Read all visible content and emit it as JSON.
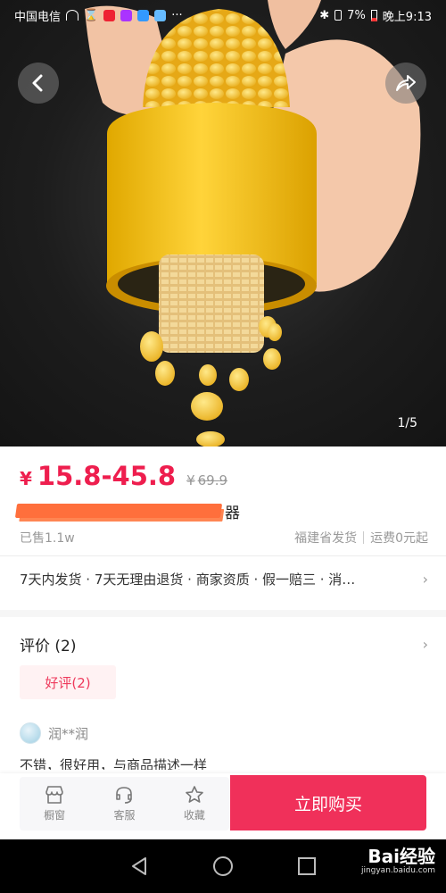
{
  "status_bar": {
    "carrier": "中国电信",
    "battery": "7%",
    "time": "晚上9:13"
  },
  "hero": {
    "page_indicator": "1/5",
    "back_icon": "chevron-left-icon",
    "share_icon": "share-arrow-icon"
  },
  "price": {
    "currency": "¥",
    "min": "15.8",
    "separator": "-",
    "max": "45.8",
    "original_currency": "¥",
    "original": "69.9"
  },
  "product": {
    "title_visible_suffix": "器",
    "sold": "已售1.1w",
    "ship_from": "福建省发货",
    "shipping_fee": "运费0元起"
  },
  "services": {
    "text": "7天内发货 · 7天无理由退货 · 商家资质 · 假一赔三 · 消…"
  },
  "reviews": {
    "title": "评价 (2)",
    "good_tag": "好评(2)",
    "reviewer_name": "润**润",
    "review_text": "不错，很好用，与商品描述一样"
  },
  "action_bar": {
    "shop_label": "橱窗",
    "service_label": "客服",
    "favorite_label": "收藏",
    "buy_label": "立即购买"
  },
  "watermark": {
    "brand": "Bai经验",
    "site": "jingyan.baidu.com"
  },
  "colors": {
    "accent": "#f0305a",
    "price": "#ee1e4e"
  }
}
